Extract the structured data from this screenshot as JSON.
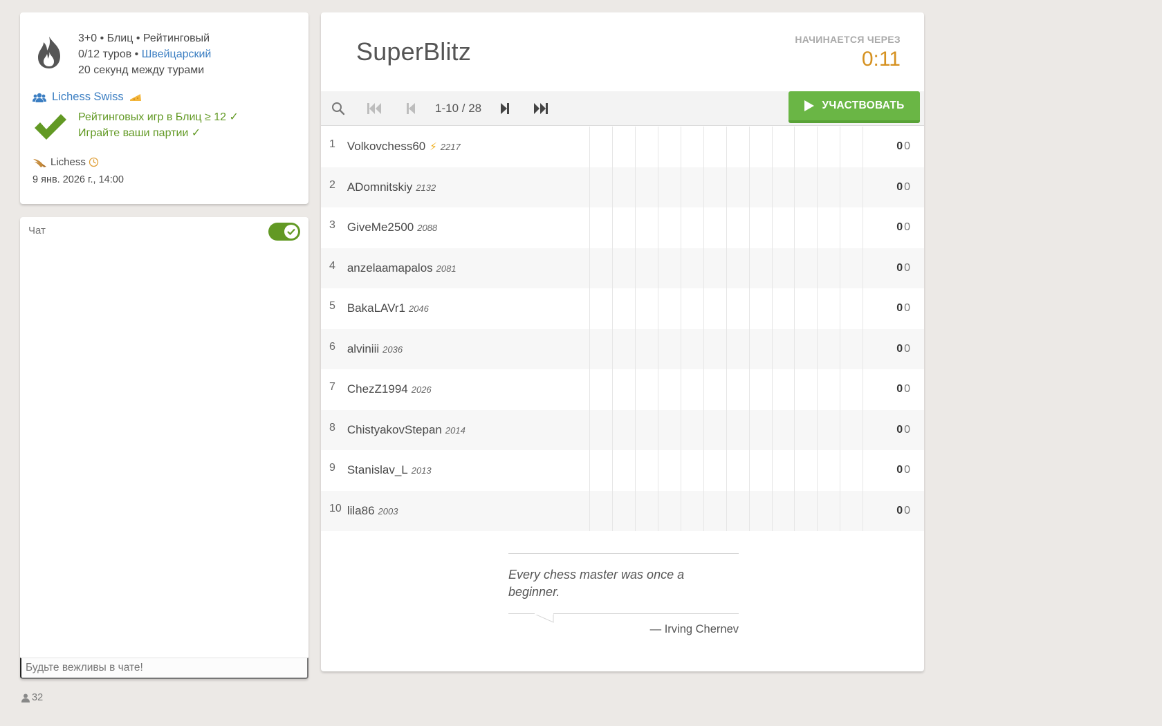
{
  "info": {
    "setup_line1": "3+0 • Блиц • Рейтинговый",
    "rounds": "0/12 туров • ",
    "system_link": "Швейцарский",
    "between": "20 секунд между турами",
    "team_link": "Lichess Swiss",
    "condition1": "Рейтинговых игр в Блиц ≥ 12 ✓",
    "condition2": "Играйте ваши партии ✓",
    "creator": "Lichess",
    "start_date": "9 янв. 2026 г., 14:00",
    "icons": [
      "flame-icon",
      "team-icon",
      "cheese-icon",
      "check-icon",
      "wings-icon",
      "clock-icon"
    ]
  },
  "chat": {
    "title": "Чат",
    "toggle_on": true,
    "placeholder": "Будьте вежливы в чате!",
    "watchers": "32"
  },
  "tournament": {
    "name": "SuperBlitz",
    "countdown_label": "НАЧИНАЕТСЯ ЧЕРЕЗ",
    "countdown": "0:11",
    "page_info": "1-10 / 28",
    "join_label": "УЧАСТВОВАТЬ"
  },
  "standings": [
    {
      "rank": "1",
      "name": "Volkovchess60",
      "bolt": true,
      "rating": "2217",
      "score": "0",
      "tb": "0"
    },
    {
      "rank": "2",
      "name": "ADomnitskiy",
      "bolt": false,
      "rating": "2132",
      "score": "0",
      "tb": "0"
    },
    {
      "rank": "3",
      "name": "GiveMe2500",
      "bolt": false,
      "rating": "2088",
      "score": "0",
      "tb": "0"
    },
    {
      "rank": "4",
      "name": "anzelaamapalos",
      "bolt": false,
      "rating": "2081",
      "score": "0",
      "tb": "0"
    },
    {
      "rank": "5",
      "name": "BakaLAVr1",
      "bolt": false,
      "rating": "2046",
      "score": "0",
      "tb": "0"
    },
    {
      "rank": "6",
      "name": "alviniii",
      "bolt": false,
      "rating": "2036",
      "score": "0",
      "tb": "0"
    },
    {
      "rank": "7",
      "name": "ChezZ1994",
      "bolt": false,
      "rating": "2026",
      "score": "0",
      "tb": "0"
    },
    {
      "rank": "8",
      "name": "ChistyakovStepan",
      "bolt": false,
      "rating": "2014",
      "score": "0",
      "tb": "0"
    },
    {
      "rank": "9",
      "name": "Stanislav_L",
      "bolt": false,
      "rating": "2013",
      "score": "0",
      "tb": "0"
    },
    {
      "rank": "10",
      "name": "lila86",
      "bolt": false,
      "rating": "2003",
      "score": "0",
      "tb": "0"
    }
  ],
  "quote": {
    "text": "Every chess master was once a beginner.",
    "author": "— Irving Chernev"
  },
  "colors": {
    "accent_green": "#629924",
    "join_green": "#6ab645",
    "link_blue": "#3b7ec2",
    "countdown_orange": "#d59120",
    "background": "#ece9e6"
  }
}
